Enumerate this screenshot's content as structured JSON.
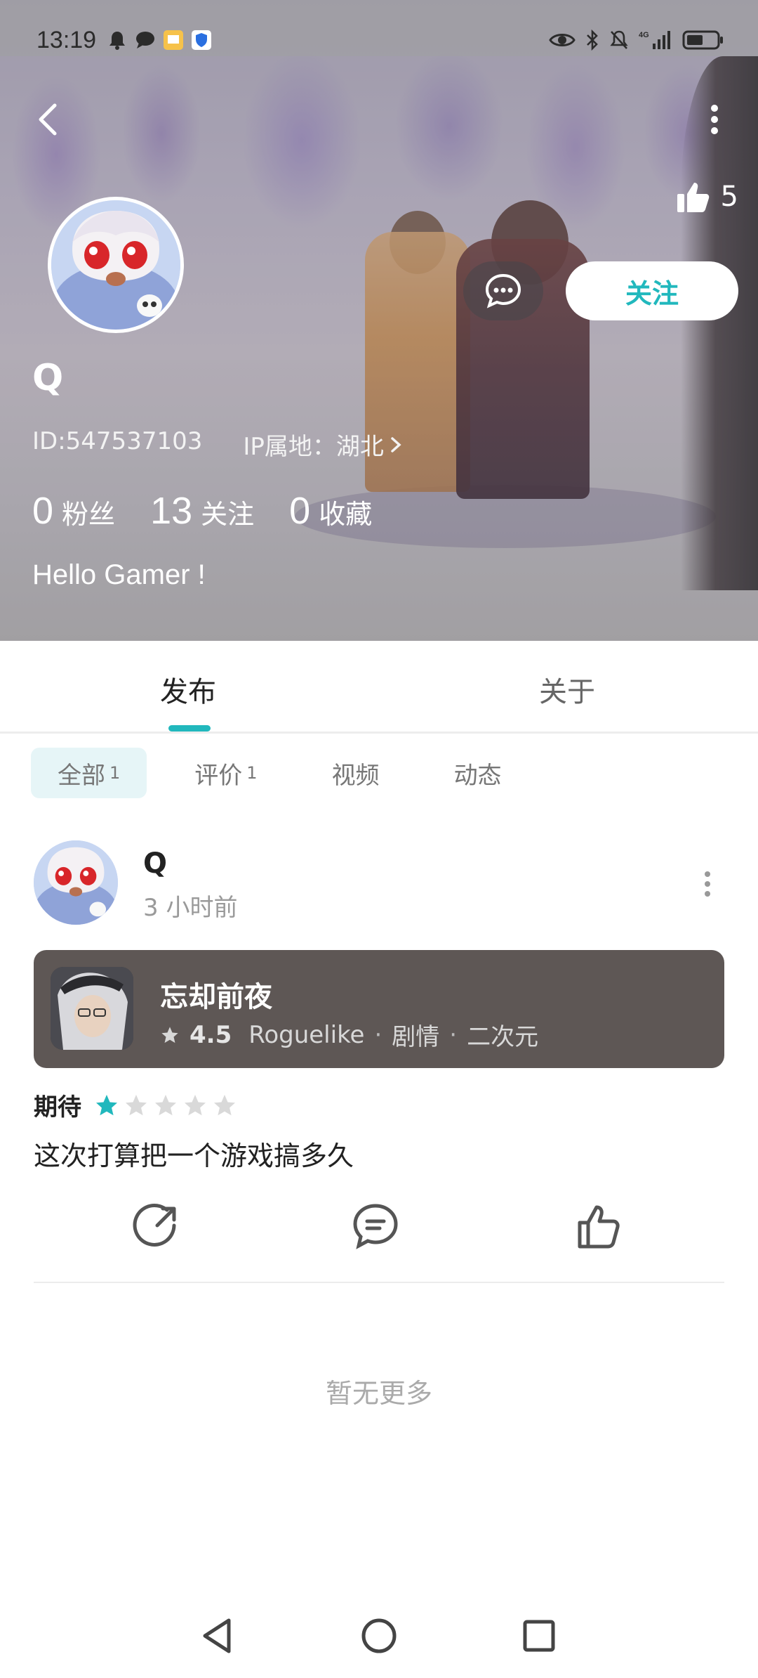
{
  "status_bar": {
    "time": "13:19",
    "left_icons": [
      "bell-icon",
      "message-bubble-icon",
      "app-icon",
      "shield-icon"
    ],
    "right_icons": [
      "eye-icon",
      "bluetooth-icon",
      "mute-icon",
      "signal-icon",
      "battery-icon"
    ],
    "network": "4G"
  },
  "profile": {
    "likes_count": "5",
    "follow_label": "关注",
    "name": "Q",
    "id_text": "ID:547537103",
    "ip_text": "IP属地：湖北",
    "stats": [
      {
        "num": "0",
        "label": "粉丝"
      },
      {
        "num": "13",
        "label": "关注"
      },
      {
        "num": "0",
        "label": "收藏"
      }
    ],
    "bio": "Hello Gamer !"
  },
  "tabs": {
    "items": [
      {
        "label": "发布",
        "active": true
      },
      {
        "label": "关于",
        "active": false
      }
    ]
  },
  "filters": [
    {
      "label": "全部",
      "count": "1",
      "active": true
    },
    {
      "label": "评价",
      "count": "1",
      "active": false
    },
    {
      "label": "视频",
      "count": "",
      "active": false
    },
    {
      "label": "动态",
      "count": "",
      "active": false
    }
  ],
  "post": {
    "user": "Q",
    "time": "3 小时前",
    "game": {
      "title": "忘却前夜",
      "score": "4.5",
      "tags": [
        "Roguelike",
        "剧情",
        "二次元"
      ]
    },
    "rating_label": "期待",
    "rating_stars": 1,
    "rating_max": 5,
    "text": "这次打算把一个游戏搞多久"
  },
  "footer": {
    "no_more": "暂无更多"
  },
  "colors": {
    "accent": "#21b8bd",
    "card_bg": "#5e5755",
    "chip_active_bg": "#e6f5f7"
  }
}
